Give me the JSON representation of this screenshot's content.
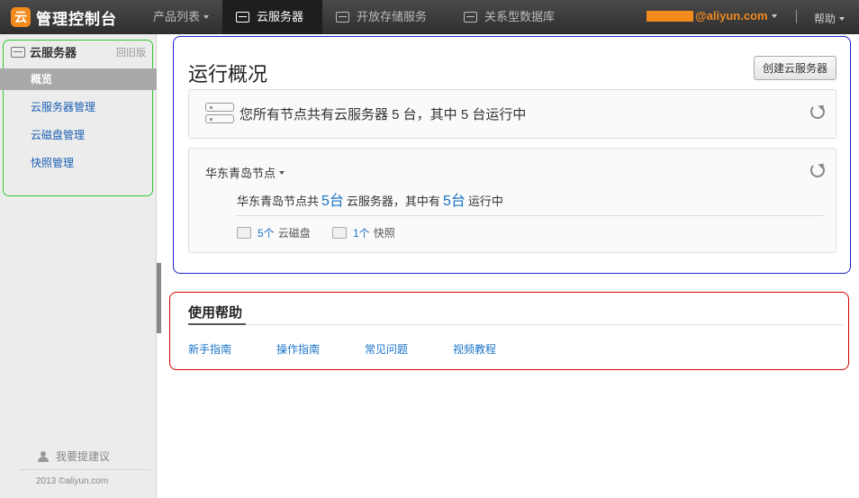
{
  "header": {
    "logo_text": "管理控制台",
    "logo_mark": "云",
    "nav": [
      {
        "label": "产品列表",
        "icon": "chevron-down-icon"
      },
      {
        "label": "云服务器",
        "icon": "server-icon",
        "active": true
      },
      {
        "label": "开放存储服务",
        "icon": "cloud-storage-icon"
      },
      {
        "label": "关系型数据库",
        "icon": "database-icon"
      }
    ],
    "email": "@aliyun.com",
    "help": "帮助"
  },
  "sidebar": {
    "title": "云服务器",
    "old_version": "回旧版",
    "items": [
      {
        "label": "概览",
        "active": true
      },
      {
        "label": "云服务器管理"
      },
      {
        "label": "云磁盘管理"
      },
      {
        "label": "快照管理"
      }
    ],
    "suggest": "我要提建议",
    "copyright": "2013 ©aliyun.com"
  },
  "overview": {
    "title": "运行概况",
    "create_button": "创建云服务器",
    "summary": "您所有节点共有云服务器 5 台，其中 5 台运行中",
    "region": {
      "name": "华东青岛节点",
      "text_pre": "华东青岛节点共",
      "total": "5台",
      "text_mid": "云服务器，其中有",
      "running": "5台",
      "text_post": "运行中",
      "disk_count": "5个",
      "disk_label": "云磁盘",
      "snapshot_count": "1个",
      "snapshot_label": "快照"
    }
  },
  "help": {
    "title": "使用帮助",
    "links": [
      "新手指南",
      "操作指南",
      "常见问题",
      "视频教程"
    ]
  },
  "colors": {
    "accent": "#f28b1c",
    "link": "#1a73c7",
    "sidebar_box": "#2fcc2f",
    "overview_box": "#1e1ed2",
    "help_box": "#d40000"
  }
}
